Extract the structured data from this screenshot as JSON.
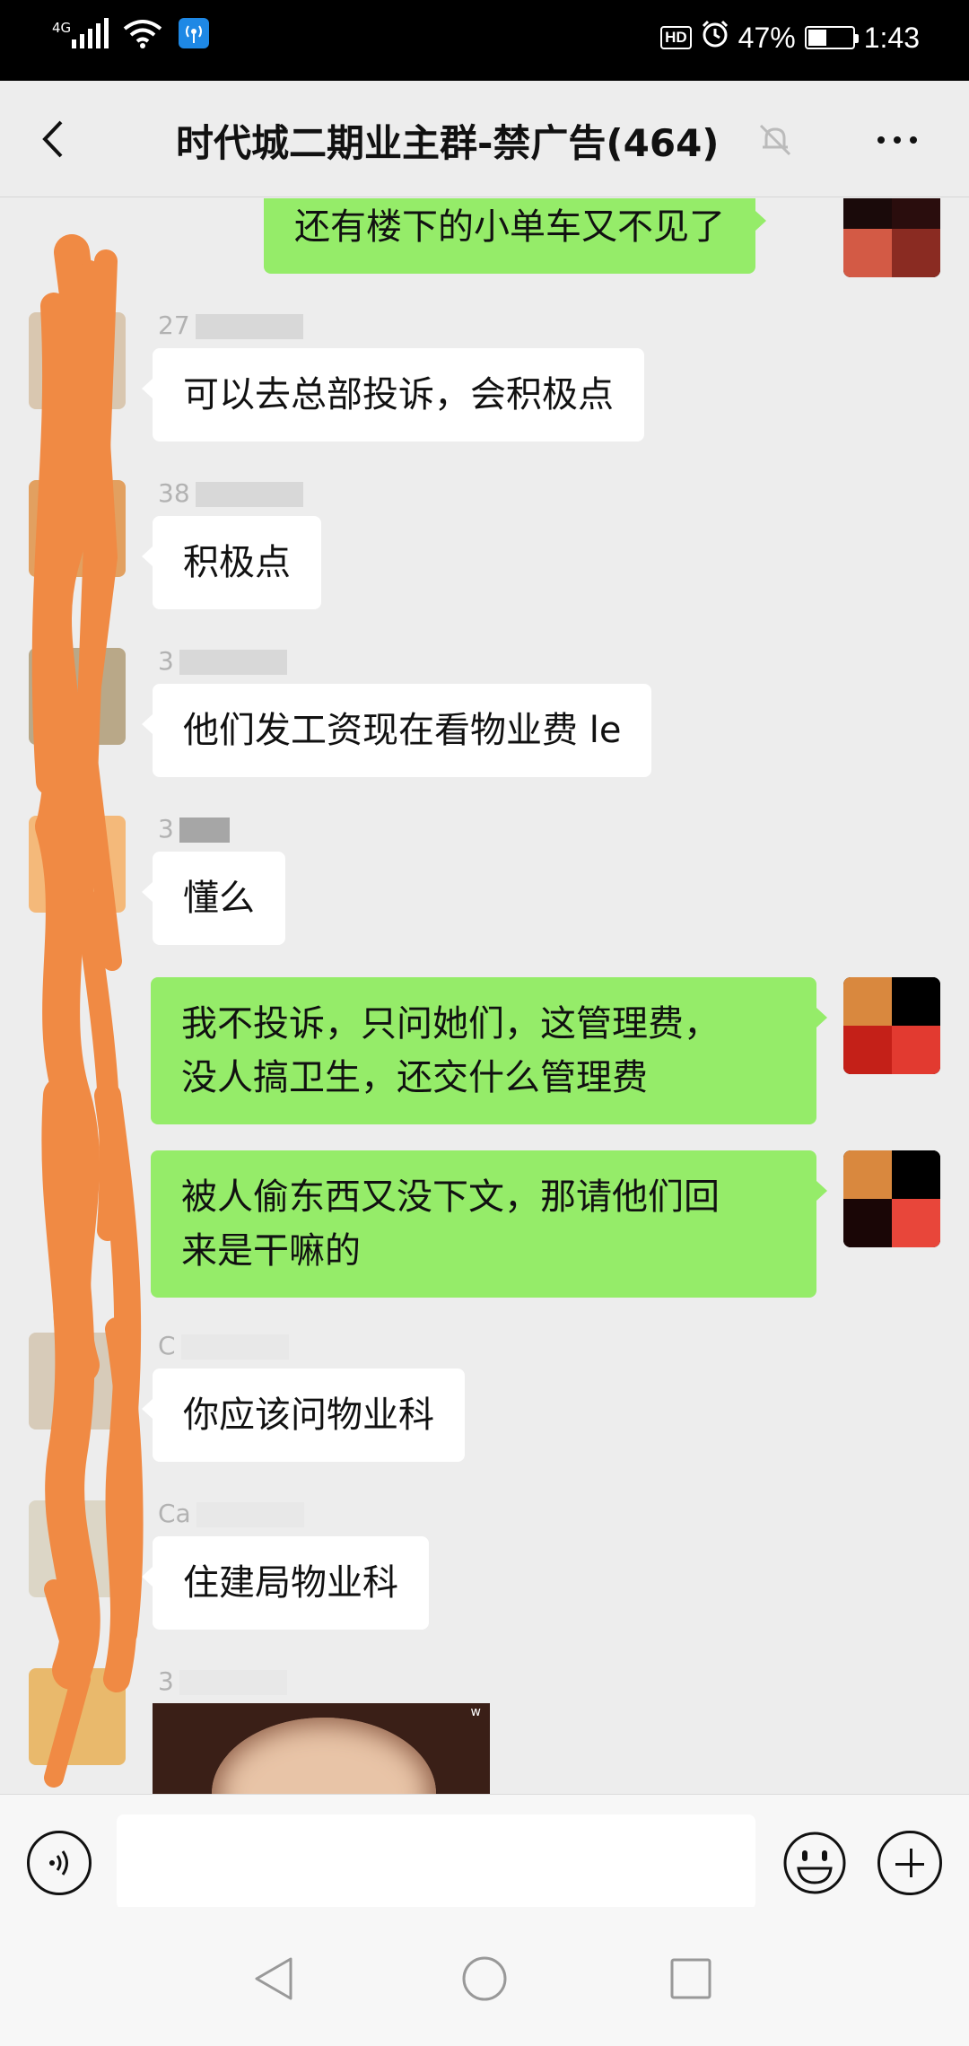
{
  "status_bar": {
    "network": "4G",
    "hd_label": "HD",
    "battery_percent": "47%",
    "battery_level": 0.47,
    "time": "1:43"
  },
  "header": {
    "title": "时代城二期业主群-禁广告(464)",
    "back_icon": "chevron-left-icon",
    "mute_icon": "bell-muted-icon",
    "more_icon": "more-dots-icon"
  },
  "messages": [
    {
      "side": "out",
      "text": "还有楼下的小单车又不见了"
    },
    {
      "side": "in",
      "sender": "27",
      "text": "可以去总部投诉，会积极点"
    },
    {
      "side": "in",
      "sender": "38",
      "text": "积极点"
    },
    {
      "side": "in",
      "sender": "3",
      "text": "他们发工资现在看物业费 le"
    },
    {
      "side": "in",
      "sender": "3",
      "text": "懂么"
    },
    {
      "side": "out",
      "text": "我不投诉，只问她们，这管理费，",
      "text2": "没人搞卫生，还交什么管理费"
    },
    {
      "side": "out",
      "text": "被人偷东西又没下文，那请他们回",
      "text2": "来是干嘛的"
    },
    {
      "side": "in",
      "sender": "C",
      "text": "你应该问物业科"
    },
    {
      "side": "in",
      "sender": "Ca",
      "text": "住建局物业科"
    },
    {
      "side": "in",
      "sender": "3",
      "text": ""
    }
  ],
  "input_bar": {
    "voice_icon": "voice-icon",
    "placeholder": "",
    "emoji_icon": "emoji-icon",
    "plus_icon": "plus-icon"
  },
  "nav_bar": {
    "back_icon": "nav-back-icon",
    "home_icon": "nav-home-icon",
    "recents_icon": "nav-recents-icon"
  },
  "colors": {
    "outgoing_bubble": "#95ec69",
    "incoming_bubble": "#ffffff",
    "chat_background": "#ededed",
    "scribble": "#f08a44"
  }
}
